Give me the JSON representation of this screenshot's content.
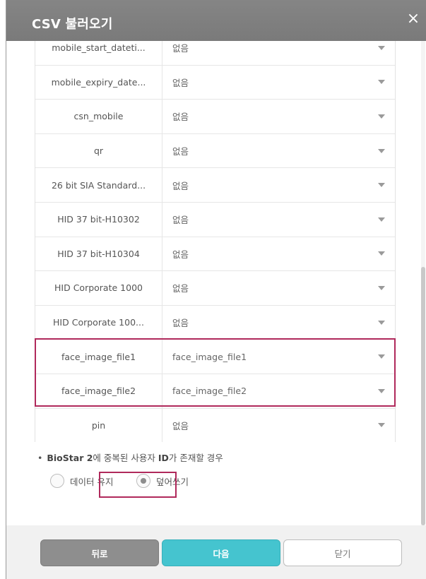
{
  "dialog": {
    "title": "CSV 불러오기",
    "close_label": "×"
  },
  "mapping_rows": [
    {
      "name": "mobile_start_dateti...",
      "value": "없음"
    },
    {
      "name": "mobile_expiry_date...",
      "value": "없음"
    },
    {
      "name": "csn_mobile",
      "value": "없음"
    },
    {
      "name": "qr",
      "value": "없음"
    },
    {
      "name": "26 bit SIA Standard...",
      "value": "없음"
    },
    {
      "name": "HID 37 bit-H10302",
      "value": "없음"
    },
    {
      "name": "HID 37 bit-H10304",
      "value": "없음"
    },
    {
      "name": "HID Corporate 1000",
      "value": "없음"
    },
    {
      "name": "HID Corporate 100...",
      "value": "없음"
    },
    {
      "name": "face_image_file1",
      "value": "face_image_file1"
    },
    {
      "name": "face_image_file2",
      "value": "face_image_file2"
    },
    {
      "name": "pin",
      "value": "없음"
    }
  ],
  "duplicate_option": {
    "bullet": "•",
    "title_bold_1": "BioStar 2",
    "title_mid": "에 중복된 사용자 ",
    "title_bold_2": "ID",
    "title_end": "가 존재할 경우",
    "keep_label": "데이터 유지",
    "overwrite_label": "덮어쓰기",
    "selected": "overwrite"
  },
  "buttons": {
    "back": "뒤로",
    "next": "다음",
    "close": "닫기"
  },
  "colors": {
    "titlebar": "#808080",
    "highlight": "#b0295b",
    "next_button": "#45c4cf"
  }
}
